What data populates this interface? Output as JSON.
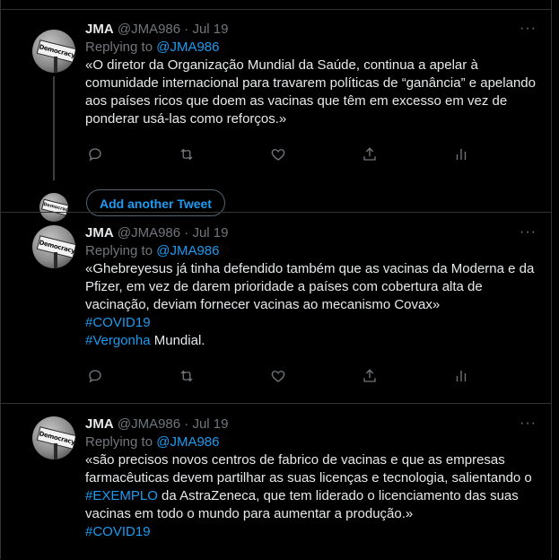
{
  "tweets": [
    {
      "name": "JMA",
      "handle": "@JMA986",
      "date": "Jul 19",
      "replying_label": "Replying to",
      "replying_handle": "@JMA986",
      "text": "«O diretor da Organização Mundial da Saúde, continua a apelar à comunidade internacional para travarem políticas de “ganância” e apelando aos países ricos que doem as vacinas que têm em excesso em vez de ponderar usá-las como reforços.»"
    },
    {
      "name": "JMA",
      "handle": "@JMA986",
      "date": "Jul 19",
      "replying_label": "Replying to",
      "replying_handle": "@JMA986",
      "text": "«Ghebreyesus já tinha defendido também que as vacinas da Moderna e da Pfizer, em vez de darem prioridade a países com cobertura alta de vacinação, deviam fornecer vacinas ao mecanismo Covax»",
      "hashtag1": "#COVID19",
      "hashtag2": "#Vergonha",
      "after_hashtag2": " Mundial."
    },
    {
      "name": "JMA",
      "handle": "@JMA986",
      "date": "Jul 19",
      "replying_label": "Replying to",
      "replying_handle": "@JMA986",
      "text_before": "«são precisos novos centros de fabrico de vacinas e que as empresas farmacêuticas devem partilhar as suas licenças e tecnologia, salientando o ",
      "hashtag_inline": "#EXEMPLO",
      "text_after": " da AstraZeneca, que tem liderado o licenciamento das suas vacinas em todo o mundo para aumentar a produção.»",
      "hashtag1": "#COVID19"
    }
  ],
  "avatar_sign_text": "Democracy",
  "add_tweet_label": "Add another Tweet",
  "separator": "·",
  "more_glyph": "···",
  "icons": [
    "reply-icon",
    "retweet-icon",
    "like-icon",
    "share-icon",
    "analytics-icon"
  ],
  "colors": {
    "accent": "#1d9bf0",
    "muted": "#71767b",
    "text": "#e7e9ea",
    "border": "#2f3336"
  }
}
